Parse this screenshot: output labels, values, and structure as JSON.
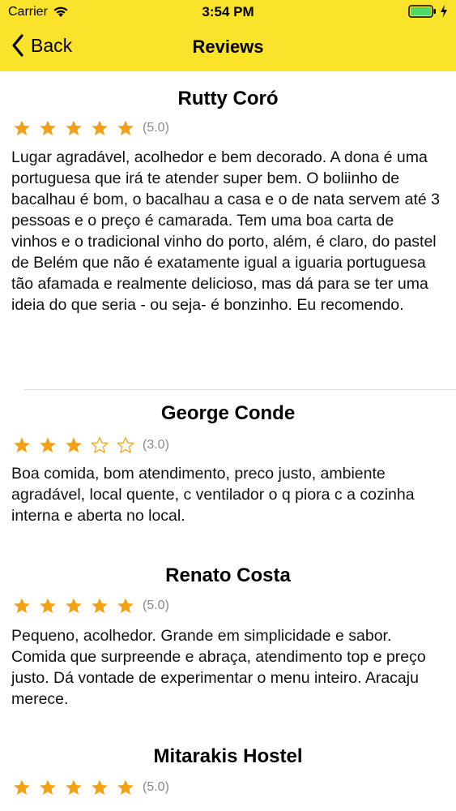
{
  "status_bar": {
    "carrier": "Carrier",
    "time": "3:54 PM"
  },
  "nav": {
    "back_label": "Back",
    "title": "Reviews"
  },
  "colors": {
    "bar": "#fbe22b",
    "star": "#f4a014"
  },
  "reviews": [
    {
      "name": "Rutty Coró",
      "stars": 5,
      "rating_label": "(5.0)",
      "text": "Lugar agradável,  acolhedor e bem decorado. A dona é uma portuguesa que irá te atender super bem. O boliinho de bacalhau é bom, o bacalhau a casa e o de nata servem até 3 pessoas e o preço é camarada. Tem uma boa carta de vinhos e o tradicional vinho do porto, além, é claro, do pastel de Belém que não é exatamente igual a iguaria portuguesa tão afamada e realmente delicioso, mas dá para se ter uma ideia do que seria - ou seja-  é bonzinho. Eu recomendo."
    },
    {
      "name": "George Conde",
      "stars": 3,
      "rating_label": "(3.0)",
      "text": "Boa comida, bom atendimento, preco justo, ambiente agradável, local quente, c ventilador o q piora c a cozinha interna e aberta no local."
    },
    {
      "name": "Renato Costa",
      "stars": 5,
      "rating_label": "(5.0)",
      "text": "Pequeno, acolhedor. Grande em simplicidade e sabor. Comida que surpreende e abraça, atendimento top e preço justo. Dá vontade de experimentar o menu inteiro. Aracaju merece."
    },
    {
      "name": "Mitarakis Hostel",
      "stars": 5,
      "rating_label": "(5.0)",
      "text": ""
    }
  ]
}
